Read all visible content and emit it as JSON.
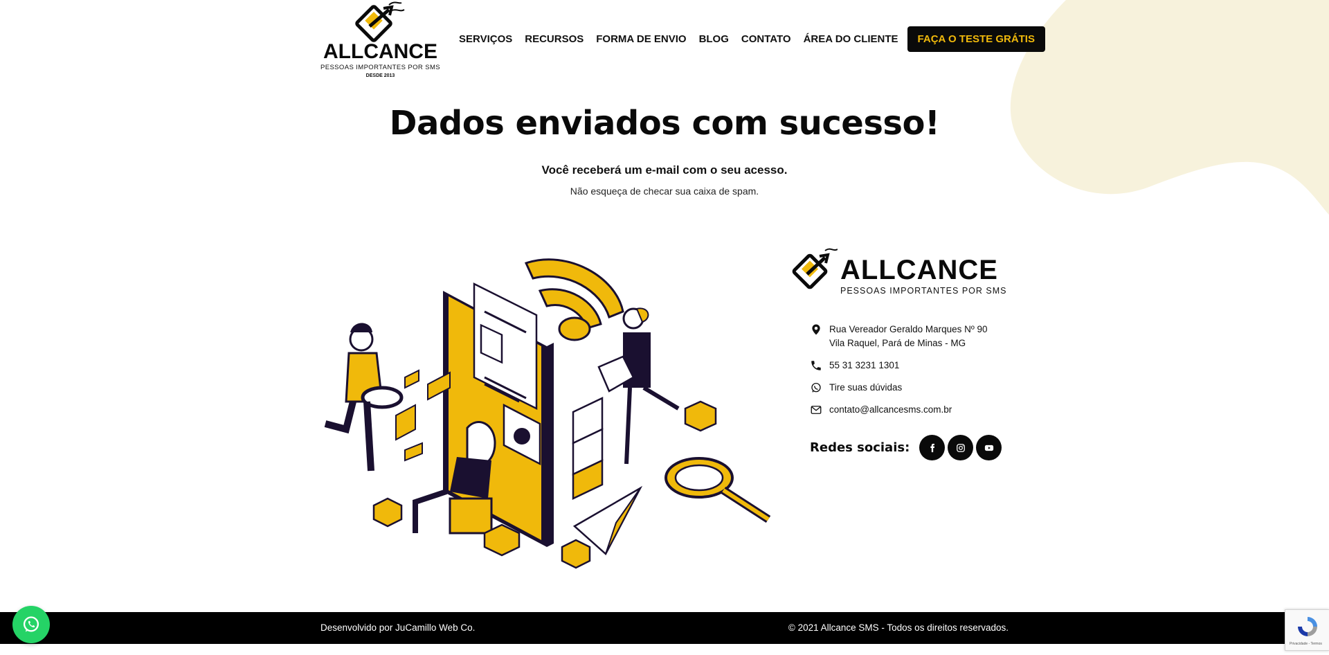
{
  "colors": {
    "accent": "#f0b90b",
    "dark": "#0a0a0a",
    "blob": "#f7f2dc",
    "whatsapp": "#25d366",
    "footer_bg": "#000000"
  },
  "header": {
    "logo": {
      "wordmark": "ALLCANCE",
      "tagline": "PESSOAS IMPORTANTES POR SMS",
      "since": "DESDE 2013"
    },
    "nav": [
      {
        "label": "SERVIÇOS"
      },
      {
        "label": "RECURSOS"
      },
      {
        "label": "FORMA DE ENVIO"
      },
      {
        "label": "BLOG"
      },
      {
        "label": "CONTATO"
      },
      {
        "label": "ÁREA DO CLIENTE"
      }
    ],
    "cta_label": "FAÇA O TESTE GRÁTIS"
  },
  "hero": {
    "title": "Dados enviados com sucesso!",
    "subtitle": "Você receberá um e-mail com o seu acesso.",
    "note": "Não esqueça de checar sua caixa de spam."
  },
  "contact": {
    "logo": {
      "wordmark": "ALLCANCE",
      "tagline": "PESSOAS IMPORTANTES POR SMS"
    },
    "address_line1": "Rua Vereador Geraldo Marques Nº 90",
    "address_line2": "Vila Raquel, Pará de Minas - MG",
    "phone": "55 31 3231 1301",
    "whatsapp_text": "Tire suas dúvidas",
    "email": "contato@allcancesms.com.br",
    "icons": [
      "map-pin-icon",
      "phone-icon",
      "whatsapp-icon",
      "mail-icon"
    ],
    "social_label": "Redes sociais:",
    "social": [
      {
        "name": "facebook",
        "icon": "facebook-icon"
      },
      {
        "name": "instagram",
        "icon": "instagram-icon"
      },
      {
        "name": "youtube",
        "icon": "youtube-icon"
      }
    ]
  },
  "footer": {
    "left": "Desenvolvido por JuCamillo Web Co.",
    "right": "© 2021 Allcance SMS - Todos os direitos reservados."
  },
  "recaptcha": {
    "text": "Privacidade - Termos"
  }
}
